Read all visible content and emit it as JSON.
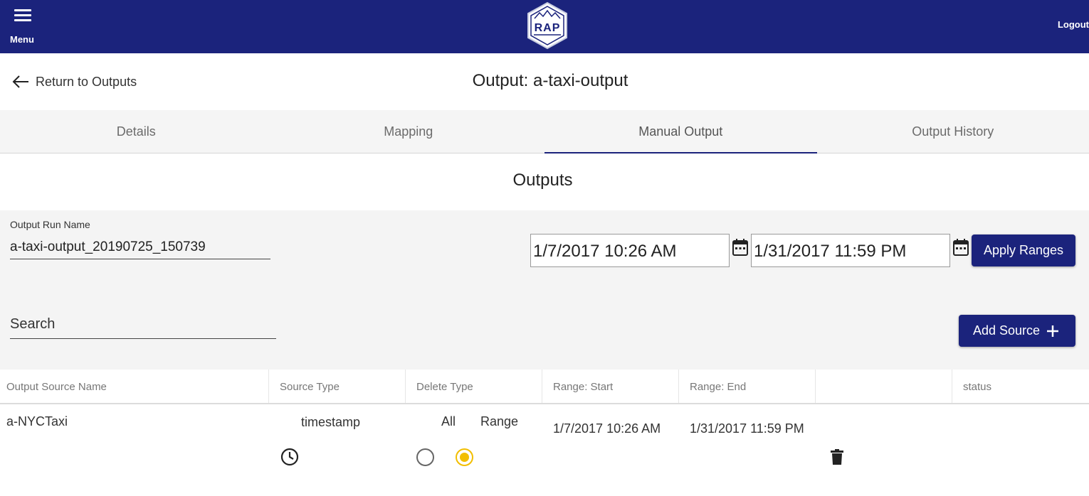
{
  "appbar": {
    "menu_label": "Menu",
    "logo_text": "RAP",
    "logout_label": "Logout"
  },
  "header": {
    "back_label": "Return to Outputs",
    "title": "Output: a-taxi-output"
  },
  "tabs": [
    {
      "label": "Details"
    },
    {
      "label": "Mapping"
    },
    {
      "label": "Manual Output"
    },
    {
      "label": "Output History"
    }
  ],
  "active_tab": "Manual Output",
  "section_title": "Outputs",
  "form": {
    "run_name_label": "Output Run Name",
    "run_name_value": "a-taxi-output_20190725_150739",
    "range_start": "1/7/2017 10:26 AM",
    "range_end": "1/31/2017 11:59 PM",
    "apply_label": "Apply Ranges",
    "search_placeholder": "Search",
    "add_source_label": "Add Source"
  },
  "table": {
    "columns": [
      "Output Source Name",
      "Source Type",
      "Delete Type",
      "Range: Start",
      "Range: End",
      "",
      "status"
    ],
    "rows": [
      {
        "name": "a-NYCTaxi",
        "source_type": "timestamp",
        "delete_type_options": [
          "All",
          "Range"
        ],
        "delete_type_selected": "Range",
        "range_start": "1/7/2017 10:26 AM",
        "range_end": "1/31/2017 11:59 PM",
        "status": ""
      }
    ]
  },
  "colors": {
    "brand": "#1b237c",
    "radio_selected": "#f2be00",
    "panel_bg": "#f4f4f4"
  },
  "icons": [
    "hamburger-icon",
    "arrow-left-icon",
    "calendar-icon",
    "plus-icon",
    "clock-icon",
    "trash-icon"
  ]
}
